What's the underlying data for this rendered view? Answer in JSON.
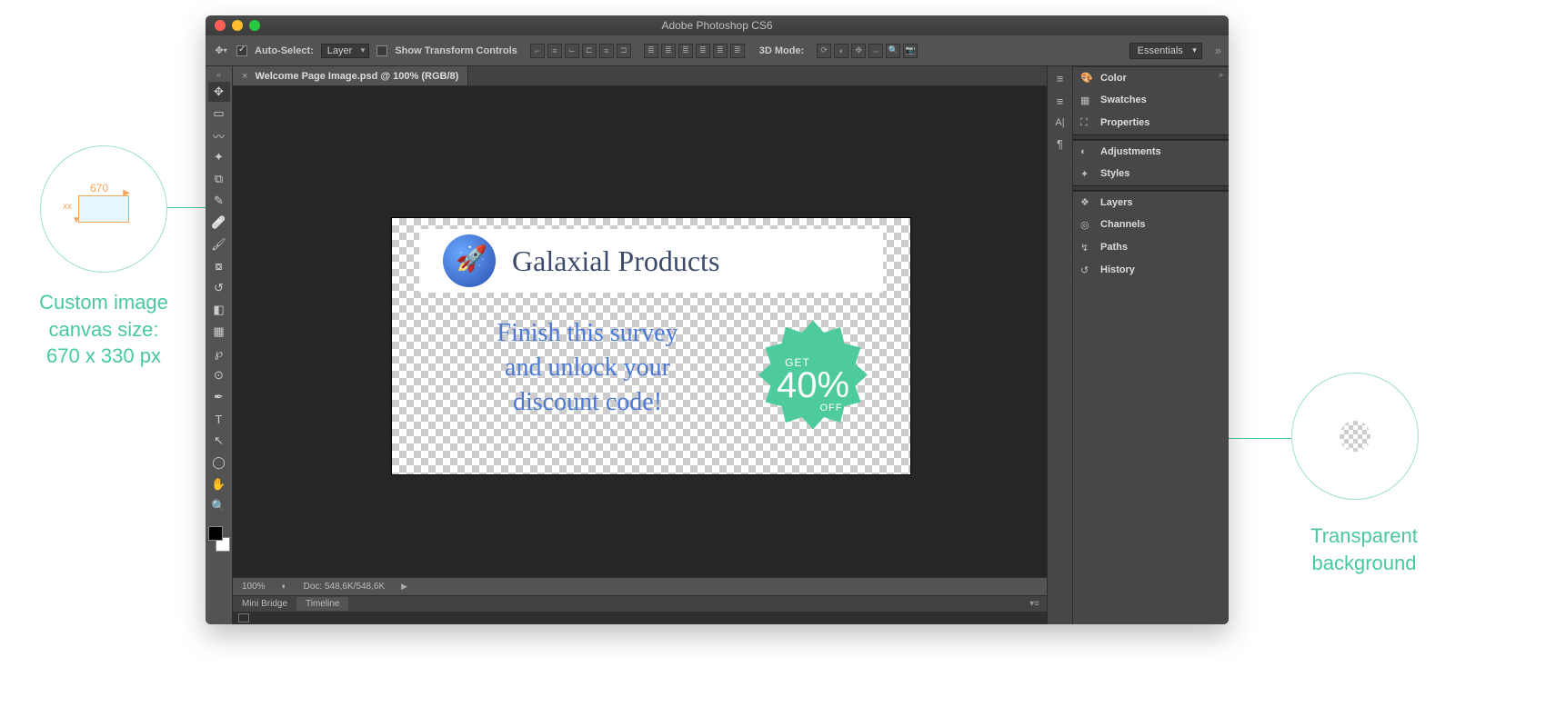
{
  "app_title": "Adobe Photoshop CS6",
  "options_bar": {
    "auto_select_label": "Auto-Select:",
    "auto_select_target": "Layer",
    "show_transform_label": "Show Transform Controls",
    "mode3d_label": "3D Mode:"
  },
  "workspace_selector": "Essentials",
  "document": {
    "tab_label": "Welcome Page Image.psd @ 100% (RGB/8)",
    "zoom": "100%",
    "doc_size": "Doc: 548,6K/548,6K"
  },
  "bottom_tabs": {
    "mini_bridge": "Mini Bridge",
    "timeline": "Timeline"
  },
  "canvas_content": {
    "brand": "Galaxial Products",
    "survey_line1": "Finish this survey",
    "survey_line2": "and unlock your",
    "survey_line3": "discount code!",
    "badge_get": "GET",
    "badge_pct": "40%",
    "badge_off": "OFF"
  },
  "panels": {
    "color": "Color",
    "swatches": "Swatches",
    "properties": "Properties",
    "adjustments": "Adjustments",
    "styles": "Styles",
    "layers": "Layers",
    "channels": "Channels",
    "paths": "Paths",
    "history": "History"
  },
  "tools": [
    "move",
    "marquee",
    "lasso",
    "wand",
    "crop",
    "eyedropper",
    "healing",
    "brush",
    "stamp",
    "history-brush",
    "eraser",
    "gradient",
    "smudge",
    "dodge",
    "pen",
    "type",
    "path-select",
    "ellipse",
    "hand",
    "zoom"
  ],
  "annotations": {
    "size_label": "Custom image\ncanvas size:\n670 x 330 px",
    "mini_width": "670",
    "mini_xx": "xx",
    "transparent_label": "Transparent\nbackground"
  }
}
